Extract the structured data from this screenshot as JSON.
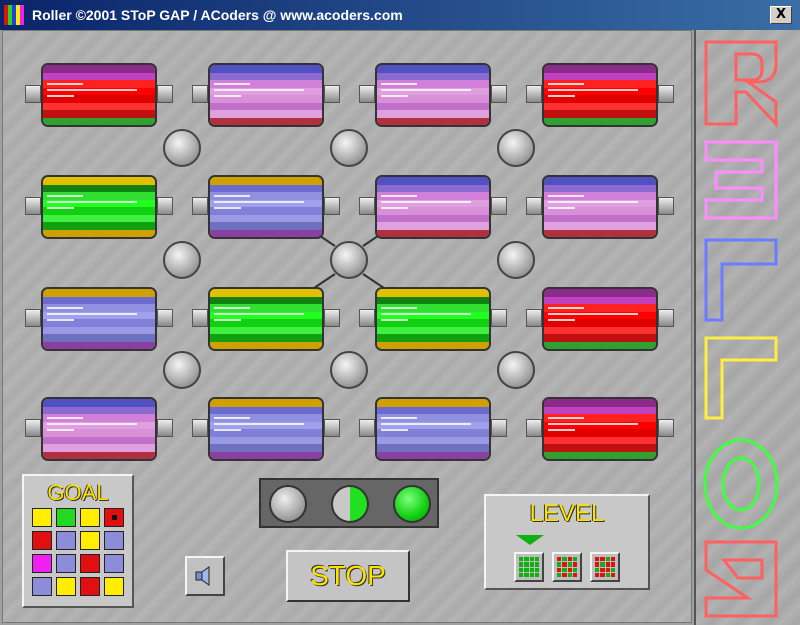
{
  "window": {
    "title": "Roller ©2001 SToP GAP / ACoders @ www.acoders.com",
    "close_label": "X"
  },
  "board": {
    "rollers": [
      {
        "row": 1,
        "col": 1,
        "color": "red"
      },
      {
        "row": 1,
        "col": 2,
        "color": "pink"
      },
      {
        "row": 1,
        "col": 3,
        "color": "pink"
      },
      {
        "row": 1,
        "col": 4,
        "color": "red"
      },
      {
        "row": 2,
        "col": 1,
        "color": "green"
      },
      {
        "row": 2,
        "col": 2,
        "color": "blue"
      },
      {
        "row": 2,
        "col": 3,
        "color": "pink"
      },
      {
        "row": 2,
        "col": 4,
        "color": "pink"
      },
      {
        "row": 3,
        "col": 1,
        "color": "blue"
      },
      {
        "row": 3,
        "col": 2,
        "color": "green"
      },
      {
        "row": 3,
        "col": 3,
        "color": "green"
      },
      {
        "row": 3,
        "col": 4,
        "color": "red"
      },
      {
        "row": 4,
        "col": 1,
        "color": "pink"
      },
      {
        "row": 4,
        "col": 2,
        "color": "blue"
      },
      {
        "row": 4,
        "col": 3,
        "color": "blue"
      },
      {
        "row": 4,
        "col": 4,
        "color": "red"
      }
    ],
    "active_knob": {
      "row": 2,
      "col": 2
    }
  },
  "goal": {
    "title": "GOAL",
    "cells": [
      [
        "yellow",
        "green",
        "yellow",
        "red-marked"
      ],
      [
        "red",
        "blue",
        "yellow",
        "blue"
      ],
      [
        "magenta",
        "blue",
        "red",
        "blue"
      ],
      [
        "blue",
        "yellow",
        "red",
        "yellow"
      ]
    ]
  },
  "lights": [
    "empty",
    "half",
    "full"
  ],
  "stop_label": "STOP",
  "level": {
    "title": "LEVEL",
    "selected": 1,
    "count": 3
  },
  "logo": {
    "letters": [
      "R",
      "E",
      "L",
      "L",
      "O",
      "R"
    ]
  },
  "colors": {
    "red": "#e01010",
    "green": "#22d822",
    "blue": "#8c8cd8",
    "pink": "#d898d8",
    "yellow": "#ffee00",
    "magenta": "#f020f0"
  }
}
